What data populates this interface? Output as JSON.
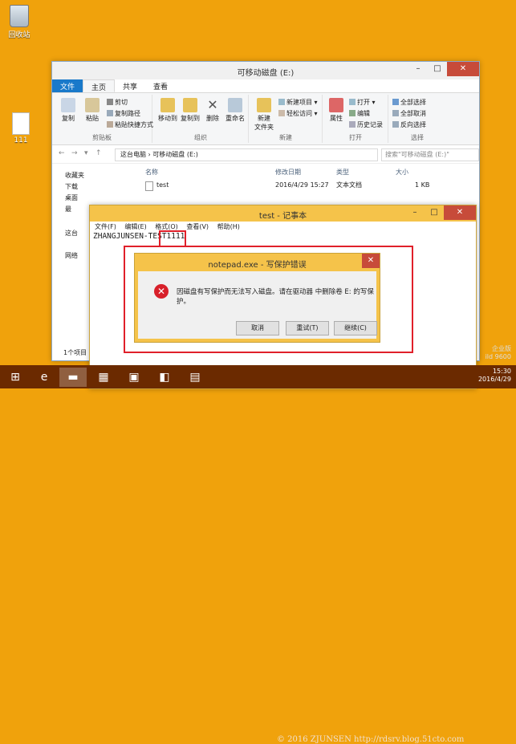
{
  "desktop": {
    "icons": [
      {
        "label": "回收站",
        "name": "recycle-bin"
      },
      {
        "label": "111",
        "name": "file-111"
      }
    ]
  },
  "explorer": {
    "title": "可移动磁盘 (E:)",
    "tabs": [
      "文件",
      "主页",
      "共享",
      "查看"
    ],
    "ribbon": {
      "clipboard": {
        "name": "剪贴板",
        "copy": "复制",
        "paste": "粘贴",
        "cut": "剪切",
        "copy_path": "复制路径",
        "paste_shortcut": "粘贴快捷方式"
      },
      "organize": {
        "name": "组织",
        "move_to": "移动到",
        "copy_to": "复制到",
        "delete": "删除",
        "rename": "重命名"
      },
      "new": {
        "name": "新建",
        "new_folder": "新建\n文件夹",
        "new_item": "新建项目",
        "easy_access": "轻松访问"
      },
      "open": {
        "name": "打开",
        "properties": "属性",
        "open": "打开",
        "edit": "编辑",
        "history": "历史记录"
      },
      "select": {
        "name": "选择",
        "select_all": "全部选择",
        "select_none": "全部取消",
        "invert": "反向选择"
      }
    },
    "address": {
      "crumbs": [
        "这台电脑",
        "可移动磁盘 (E:)"
      ],
      "search_placeholder": "搜索\"可移动磁盘 (E:)\""
    },
    "nav": {
      "favorites": "收藏夹",
      "downloads": "下载",
      "desktop": "桌面",
      "recent": "最",
      "this_pc": "这台",
      "network": "网络"
    },
    "columns": {
      "name": "名称",
      "modified": "修改日期",
      "type": "类型",
      "size": "大小"
    },
    "files": [
      {
        "name": "test",
        "modified": "2016/4/29 15:27",
        "type": "文本文档",
        "size": "1 KB"
      }
    ],
    "status": "1个项目"
  },
  "notepad": {
    "title": "test - 记事本",
    "menu": [
      "文件(F)",
      "编辑(E)",
      "格式(O)",
      "查看(V)",
      "帮助(H)"
    ],
    "content_prefix": "ZHANGJUNSEN-TEST",
    "content_highlight": "1111"
  },
  "dialog": {
    "title": "notepad.exe - 写保护错误",
    "message": "因磁盘有写保护而无法写入磁盘。请在驱动器 中删除卷 E: 的写保护。",
    "buttons": {
      "cancel": "取消",
      "retry": "重试(T)",
      "continue": "继续(C)"
    }
  },
  "taskbar": {
    "watermark": "© 2016 ZJUNSEN http://rdsrv.blog.51cto.com",
    "edition": "企业版",
    "build": "ild 9600",
    "time": "15:30",
    "date": "2016/4/29"
  },
  "colors": {
    "accent": "#1979ca",
    "desktop": "#f0a20c",
    "error": "#d8202a"
  }
}
